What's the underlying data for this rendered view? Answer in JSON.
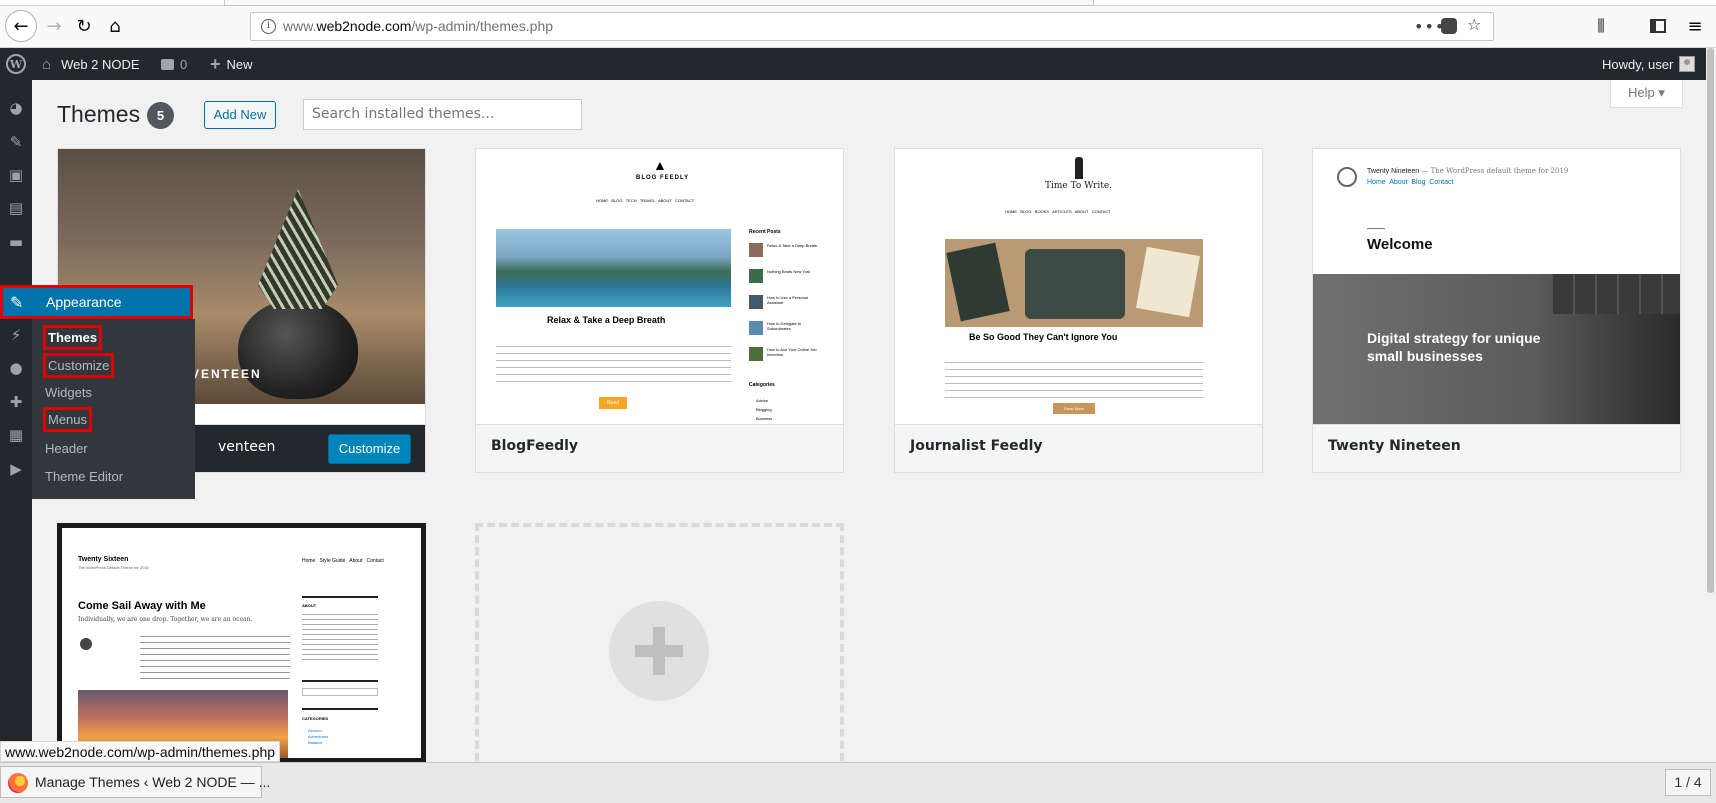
{
  "browser": {
    "url_prefix": "www.",
    "url_host": "web2node.com",
    "url_path": "/wp-admin/themes.php",
    "status_url": "www.web2node.com/wp-admin/themes.php"
  },
  "adminbar": {
    "site_name": "Web 2 NODE",
    "comments_count": "0",
    "new_label": "New",
    "greeting": "Howdy, user"
  },
  "sidebar": {
    "appearance_label": "Appearance",
    "submenu": [
      {
        "label": "Themes",
        "current": true,
        "highlighted": true
      },
      {
        "label": "Customize",
        "current": false,
        "highlighted": true
      },
      {
        "label": "Widgets",
        "current": false,
        "highlighted": false
      },
      {
        "label": "Menus",
        "current": false,
        "highlighted": true
      },
      {
        "label": "Header",
        "current": false,
        "highlighted": false
      },
      {
        "label": "Theme Editor",
        "current": false,
        "highlighted": false
      }
    ]
  },
  "header": {
    "title": "Themes",
    "count": "5",
    "add_new": "Add New",
    "search_placeholder": "Search installed themes...",
    "help": "Help"
  },
  "themes": [
    {
      "name_visible": "venteen",
      "action": "Customize",
      "active": true,
      "shot_word": "VENTEEN"
    },
    {
      "name": "BlogFeedly",
      "shot": {
        "brand": "BLOG FEEDLY",
        "nav": "HOME   BLOG   TECH   TRAVEL   ABOUT   CONTACT",
        "headline": "Relax & Take a Deep Breath",
        "sidebar_title": "Recent Posts",
        "posts": [
          "Relax & Take a Deep Breath",
          "Nothing Beats New York",
          "How to Use a Personal Assistant",
          "How to Delegate to Subordinates",
          "How to Ace Your Online Job Interview"
        ],
        "categories_title": "Categories",
        "categories": [
          "Advice",
          "Blogging",
          "Business"
        ],
        "button": "Read"
      }
    },
    {
      "name": "Journalist Feedly",
      "shot": {
        "brand": "Time To Write.",
        "nav": "HOME   BLOG   BOOKS   ARTICLES   ABOUT   CONTACT",
        "headline": "Be So Good They Can't Ignore You",
        "button": "Read More"
      }
    },
    {
      "name": "Twenty Nineteen",
      "shot": {
        "brand": "Twenty Nineteen",
        "tagline": "— The WordPress default theme for 2019",
        "links": [
          "Home",
          "About",
          "Blog",
          "Contact"
        ],
        "welcome": "Welcome",
        "hero": "Digital strategy for unique small businesses"
      }
    },
    {
      "name": "Twenty Sixteen",
      "shot": {
        "brand": "Twenty Sixteen",
        "tagline": "The WordPress Default Theme for 2016",
        "nav": [
          "Home",
          "Style Guide",
          "About",
          "Contact"
        ],
        "headline": "Come Sail Away with Me",
        "subhead": "Individually, we are one drop. Together, we are an ocean.",
        "about": "ABOUT",
        "categories": "CATEGORIES",
        "cat_items": [
          "Almond",
          "Adventures",
          "Balance"
        ]
      }
    }
  ],
  "taskbar": {
    "window_title": "Manage Themes ‹ Web 2 NODE — ...",
    "pager": "1 / 4"
  }
}
